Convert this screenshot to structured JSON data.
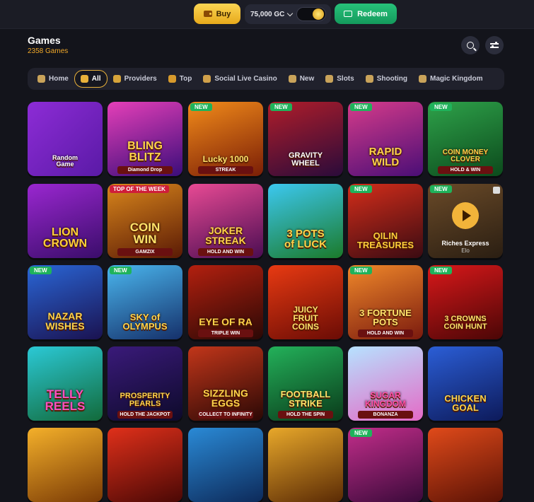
{
  "topbar": {
    "buy_label": "Buy",
    "currency_value": "75,000 GC",
    "redeem_label": "Redeem"
  },
  "header": {
    "title": "Games",
    "count": "2358 Games"
  },
  "tabs": [
    {
      "label": "Home",
      "icon": "home-icon",
      "color": "#c9a35a"
    },
    {
      "label": "All",
      "icon": "rocket-icon",
      "color": "#e8b13a",
      "active": true
    },
    {
      "label": "Providers",
      "icon": "coin-icon",
      "color": "#d6a43a"
    },
    {
      "label": "Top",
      "icon": "trophy-icon",
      "color": "#d79a2c"
    },
    {
      "label": "Social Live Casino",
      "icon": "cube-icon",
      "color": "#d0a04a"
    },
    {
      "label": "New",
      "icon": "new-icon",
      "color": "#c9a35a"
    },
    {
      "label": "Slots",
      "icon": "cherry-icon",
      "color": "#c9a35a"
    },
    {
      "label": "Shooting",
      "icon": "target-icon",
      "color": "#c9a35a"
    },
    {
      "label": "Magic Kingdom",
      "icon": "wand-icon",
      "color": "#c9a35a"
    }
  ],
  "games": [
    {
      "name": "Random\nGame",
      "bg": "linear-gradient(135deg,#8d2cd6,#5a1aa6)",
      "text_color": "#ffffff",
      "size": 9
    },
    {
      "name": "BLING\nBLITZ",
      "sub": "Diamond Drop",
      "bg": "linear-gradient(160deg,#e53fb8,#3a0d7a)",
      "text_color": "#ffd34a",
      "size": 16
    },
    {
      "name": "Lucky 1000",
      "sub": "STREAK",
      "badge": "NEW",
      "bg": "linear-gradient(160deg,#f28b1a,#7a1e06)",
      "text_color": "#ffe36a",
      "size": 12
    },
    {
      "name": "GRAVITY\nWHEEL",
      "badge": "NEW",
      "bg": "linear-gradient(160deg,#b01d2a,#2a0b3a)",
      "text_color": "#ffffff",
      "size": 11
    },
    {
      "name": "RAPID\nWILD",
      "badge": "NEW",
      "bg": "linear-gradient(160deg,#d63b8a,#4a0e76)",
      "text_color": "#ffd34a",
      "size": 15
    },
    {
      "name": "COIN MONEY\nCLOVER",
      "sub": "HOLD & WIN",
      "badge": "NEW",
      "bg": "linear-gradient(160deg,#2ea24a,#0c4a1c)",
      "text_color": "#ffd34a",
      "size": 10
    },
    {
      "name": "LION\nCROWN",
      "bg": "linear-gradient(160deg,#9a27d0,#3a0d6a)",
      "text_color": "#ffcf3a",
      "size": 16
    },
    {
      "name": "COIN\nWIN",
      "sub": "GAMZIX",
      "badge": "TOP OF THE WEEK",
      "top": true,
      "bg": "linear-gradient(160deg,#d9861c,#5a1a05)",
      "text_color": "#ffe36a",
      "size": 17
    },
    {
      "name": "JOKER\nSTREAK",
      "sub": "HOLD AND WIN",
      "bg": "linear-gradient(160deg,#e84a94,#4a0d52)",
      "text_color": "#ffd34a",
      "size": 14
    },
    {
      "name": "3 POTS\nof LUCK",
      "bg": "linear-gradient(160deg,#3cc8f0,#1b7a2a)",
      "text_color": "#ffd34a",
      "size": 15
    },
    {
      "name": "QILIN\nTREASURES",
      "badge": "NEW",
      "bg": "linear-gradient(160deg,#d42d1a,#3a0b12)",
      "text_color": "#ffcf3a",
      "size": 13
    },
    {
      "name": "Riches Express",
      "provider": "Elo",
      "badge": "NEW",
      "bg": "linear-gradient(160deg,#6a4a28,#2a1e12)",
      "text_color": "#ffffff",
      "size": 9,
      "play": true
    },
    {
      "name": "NAZAR\nWISHES",
      "badge": "NEW",
      "bg": "linear-gradient(160deg,#2a66d6,#1a1250)",
      "text_color": "#ffd34a",
      "size": 14
    },
    {
      "name": "SKY of\nOLYMPUS",
      "badge": "NEW",
      "bg": "linear-gradient(160deg,#4ab6ee,#15306a)",
      "text_color": "#ffd34a",
      "size": 13
    },
    {
      "name": "EYE OF RA",
      "sub": "TRIPLE WIN",
      "bg": "linear-gradient(160deg,#b3200f,#2a0805)",
      "text_color": "#ffd34a",
      "size": 14
    },
    {
      "name": "JUICY\nFRUIT\nCOINS",
      "bg": "linear-gradient(160deg,#e83a12,#6a0c05)",
      "text_color": "#ffe36a",
      "size": 12
    },
    {
      "name": "3 FORTUNE\nPOTS",
      "sub": "HOLD AND WIN",
      "badge": "NEW",
      "bg": "linear-gradient(160deg,#f0882a,#7a1a0e)",
      "text_color": "#ffe36a",
      "size": 13
    },
    {
      "name": "3 CROWNS\nCOIN HUNT",
      "badge": "NEW",
      "bg": "linear-gradient(160deg,#d9181a,#4a0606)",
      "text_color": "#ffe36a",
      "size": 11
    },
    {
      "name": "TELLY\nREELS",
      "bg": "linear-gradient(160deg,#2bc9d6,#126a3a)",
      "text_color": "#ff4fbf",
      "size": 17
    },
    {
      "name": "PROSPERITY\nPEARLS",
      "sub": "HOLD THE JACKPOT",
      "bg": "linear-gradient(160deg,#3a1a7a,#0d0a2a)",
      "text_color": "#ffd34a",
      "size": 11
    },
    {
      "name": "SIZZLING\nEGGS",
      "sub": "COLLECT TO INFINITY",
      "bg": "linear-gradient(160deg,#c2361a,#2a0805)",
      "text_color": "#ffd34a",
      "size": 14
    },
    {
      "name": "FOOTBALL\nSTRIKE",
      "sub": "HOLD THE SPIN",
      "bg": "linear-gradient(160deg,#23b15a,#0a3a1a)",
      "text_color": "#ffe36a",
      "size": 13
    },
    {
      "name": "SUGAR\nKINGDOM",
      "sub": "BONANZA",
      "bg": "linear-gradient(160deg,#b6e2ff,#e46ac6)",
      "text_color": "#ff4fa8",
      "size": 12
    },
    {
      "name": "CHICKEN\nGOAL",
      "bg": "linear-gradient(160deg,#2b5ed6,#0d1a5a)",
      "text_color": "#ffd34a",
      "size": 13
    },
    {
      "name": "",
      "bg": "linear-gradient(160deg,#f4b02a,#7a3a05)",
      "text_color": "#ffffff",
      "size": 10
    },
    {
      "name": "",
      "bg": "linear-gradient(160deg,#e0301a,#4a0805)",
      "text_color": "#ffffff",
      "size": 10
    },
    {
      "name": "",
      "bg": "linear-gradient(160deg,#2a8ad6,#0d2a5a)",
      "text_color": "#ffffff",
      "size": 10
    },
    {
      "name": "",
      "bg": "linear-gradient(160deg,#e8a82a,#5a2a05)",
      "text_color": "#ffffff",
      "size": 10
    },
    {
      "name": "",
      "badge": "NEW",
      "bg": "linear-gradient(160deg,#c22d8a,#3a0a3a)",
      "text_color": "#ffffff",
      "size": 10
    },
    {
      "name": "",
      "bg": "linear-gradient(160deg,#e04a1a,#5a1205)",
      "text_color": "#ffffff",
      "size": 10
    }
  ]
}
